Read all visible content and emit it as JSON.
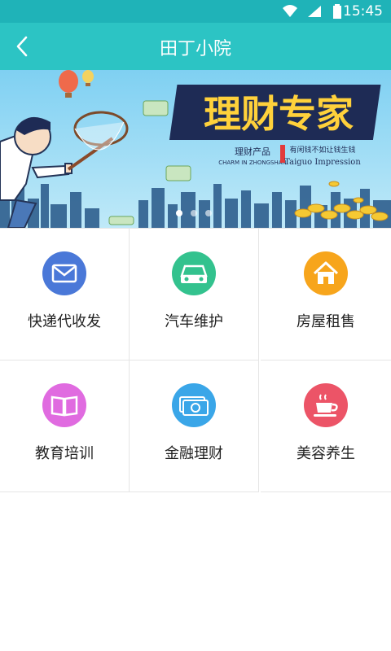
{
  "status": {
    "time": "15:45"
  },
  "header": {
    "title": "田丁小院"
  },
  "banner": {
    "headline": "理财专家",
    "sub_tag": "理财产品",
    "sub_en": "CHARM IN ZHONGSHAN",
    "quote_cn": "有闲钱不如让钱生钱",
    "quote_en": "Taiguo Impression",
    "dots": 3,
    "active_dot": 0
  },
  "services": [
    {
      "label": "快递代收发",
      "icon": "mail-icon",
      "color": "#4a78d8"
    },
    {
      "label": "汽车维护",
      "icon": "car-icon",
      "color": "#33c28e"
    },
    {
      "label": "房屋租售",
      "icon": "house-icon",
      "color": "#f7a51c"
    },
    {
      "label": "教育培训",
      "icon": "book-icon",
      "color": "#e06be0"
    },
    {
      "label": "金融理财",
      "icon": "money-icon",
      "color": "#3aa6e8"
    },
    {
      "label": "美容养生",
      "icon": "cup-icon",
      "color": "#ec5467"
    }
  ]
}
